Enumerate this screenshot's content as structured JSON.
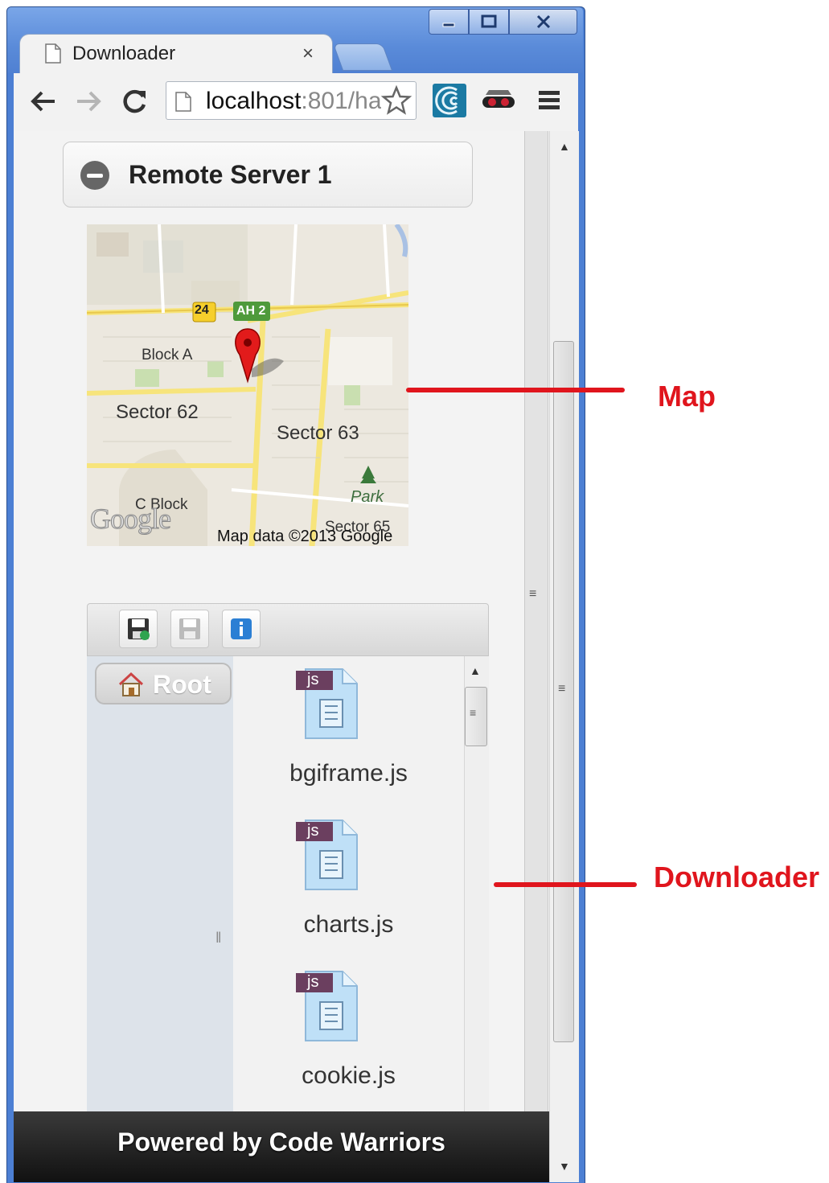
{
  "browser": {
    "tab_title": "Downloader",
    "tab_close": "×",
    "url_host": "localhost",
    "url_rest": ":801/ha"
  },
  "panel": {
    "title": "Remote Server 1"
  },
  "map": {
    "labels": [
      "24",
      "AH 2",
      "Block A",
      "Sector 62",
      "Sector 63",
      "Park",
      "C Block",
      "Sector 65"
    ],
    "google": "Google",
    "attribution": "Map data ©2013 Google"
  },
  "downloader": {
    "root_label": "Root",
    "files": [
      {
        "name": "bgiframe.js",
        "badge": "js"
      },
      {
        "name": "charts.js",
        "badge": "js"
      },
      {
        "name": "cookie.js",
        "badge": "js"
      }
    ]
  },
  "footer": {
    "text": "Powered by Code Warriors"
  },
  "annotations": {
    "map": "Map",
    "downloader": "Downloader",
    "color": "#e0151d"
  }
}
